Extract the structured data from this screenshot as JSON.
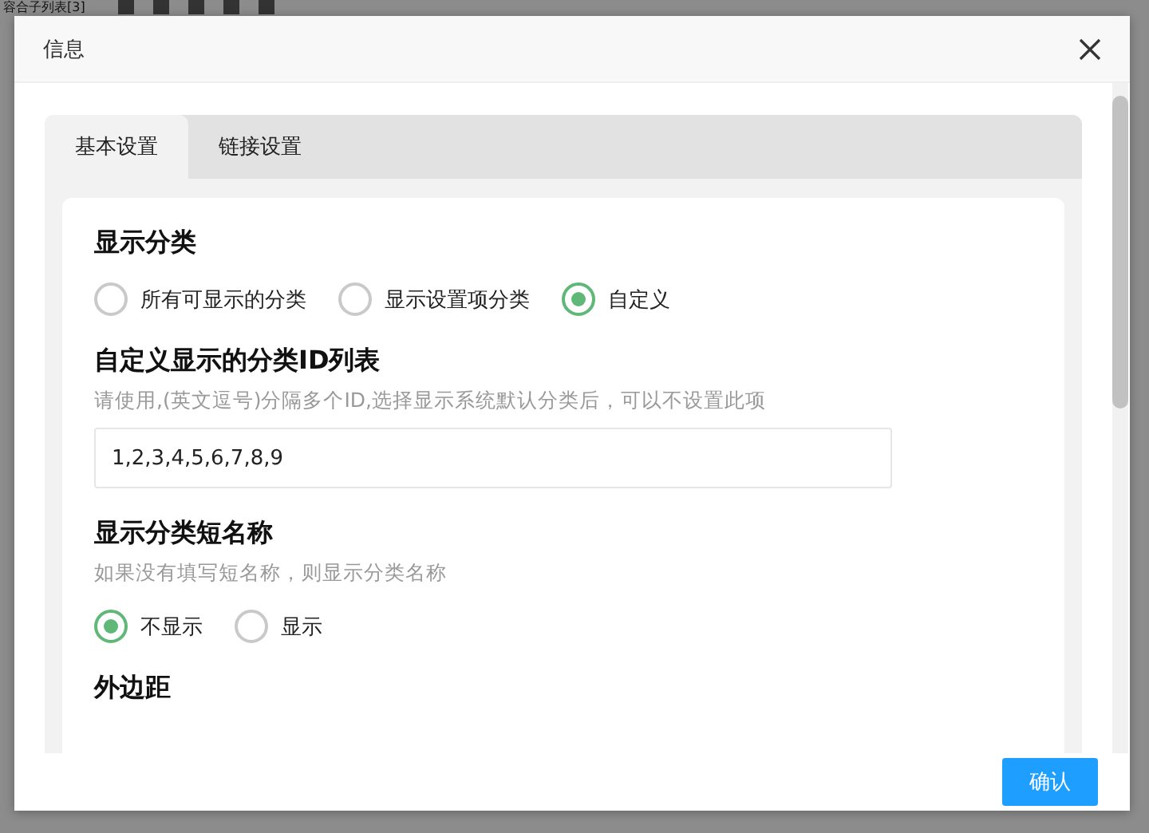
{
  "background": {
    "list_title": "容合子列表[3]"
  },
  "dialog": {
    "title": "信息"
  },
  "tabs": [
    {
      "label": "基本设置",
      "selected": true
    },
    {
      "label": "链接设置",
      "selected": false
    }
  ],
  "sections": [
    {
      "kind": "radio",
      "title": "显示分类",
      "options": [
        {
          "label": "所有可显示的分类",
          "selected": false
        },
        {
          "label": "显示设置项分类",
          "selected": false
        },
        {
          "label": "自定义",
          "selected": true
        }
      ]
    },
    {
      "kind": "text",
      "title": "自定义显示的分类ID列表",
      "hint": "请使用,(英文逗号)分隔多个ID,选择显示系统默认分类后，可以不设置此项",
      "value": "1,2,3,4,5,6,7,8,9"
    },
    {
      "kind": "radio",
      "title": "显示分类短名称",
      "hint": "如果没有填写短名称，则显示分类名称",
      "options": [
        {
          "label": "不显示",
          "selected": true
        },
        {
          "label": "显示",
          "selected": false
        }
      ]
    },
    {
      "kind": "heading",
      "title": "外边距"
    }
  ],
  "confirm_button": "确认"
}
